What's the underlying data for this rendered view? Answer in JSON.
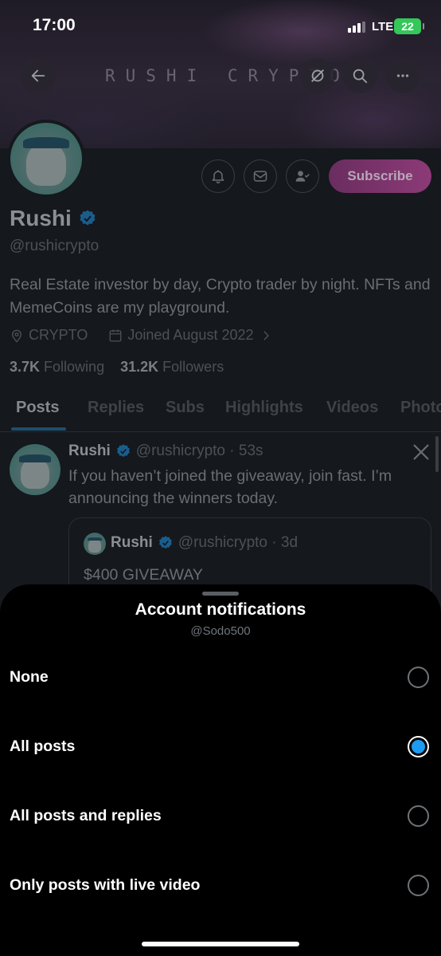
{
  "status_bar": {
    "time": "17:00",
    "network": "LTE",
    "battery": "22"
  },
  "banner": {
    "text": "RUSHI CRYPTO"
  },
  "profile": {
    "name": "Rushi",
    "handle": "@rushicrypto",
    "bio": "Real Estate investor by day, Crypto trader by night. NFTs and MemeCoins are my playground.",
    "location": "CRYPTO",
    "joined": "Joined August 2022",
    "following_count": "3.7K",
    "following_label": "Following",
    "followers_count": "31.2K",
    "followers_label": "Followers",
    "subscribe_label": "Subscribe"
  },
  "tabs": [
    "Posts",
    "Replies",
    "Subs",
    "Highlights",
    "Videos",
    "Photos"
  ],
  "post": {
    "name": "Rushi",
    "handle_time": "@rushicrypto · 53s",
    "text": "If you haven’t joined the giveaway, join fast. I’m announcing the winners today.",
    "quote": {
      "name": "Rushi",
      "handle_time": "@rushicrypto · 3d",
      "text": "$400 GIVEAWAY"
    }
  },
  "sheet": {
    "title": "Account notifications",
    "subtitle": "@Sodo500",
    "options": [
      {
        "label": "None",
        "selected": false
      },
      {
        "label": "All posts",
        "selected": true
      },
      {
        "label": "All posts and replies",
        "selected": false
      },
      {
        "label": "Only posts with live video",
        "selected": false
      }
    ]
  },
  "colors": {
    "accent": "#1d9bf0",
    "subscribe": "#8c3a77",
    "battery": "#34c759"
  },
  "icons": [
    "back-arrow-icon",
    "hide-icon",
    "search-icon",
    "more-icon",
    "notification-bell-icon",
    "mail-icon",
    "following-user-icon",
    "verified-badge-icon",
    "location-icon",
    "calendar-icon",
    "chevron-right-icon",
    "x-logo-icon"
  ]
}
